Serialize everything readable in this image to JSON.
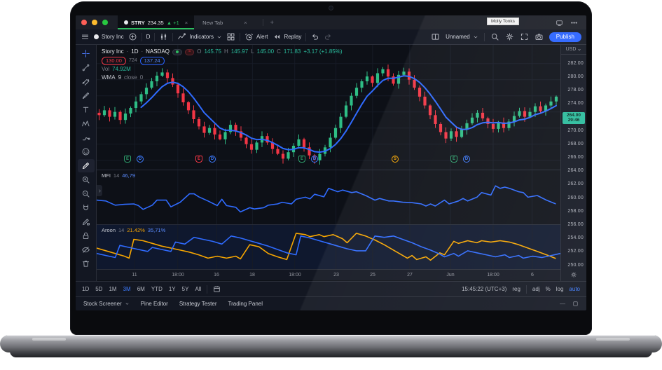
{
  "browser": {
    "tab_active": {
      "symbol": "STRY",
      "price": "234.35",
      "change": "▲ +1",
      "close": "×"
    },
    "tab_new": {
      "title": "New Tab",
      "close": "×"
    },
    "new_tab_button": "+",
    "user_tooltip": "Molly Tonks"
  },
  "toolbar": {
    "symbol_name": "Story Inc",
    "interval": "D",
    "indicators_label": "Indicators",
    "alert_label": "Alert",
    "replay_label": "Replay",
    "layout_name": "Unnamed",
    "publish_label": "Publish"
  },
  "side_toolbar": {
    "tools": [
      {
        "name": "crosshair",
        "blue": true
      },
      {
        "name": "trendline"
      },
      {
        "name": "channel"
      },
      {
        "name": "brush"
      },
      {
        "name": "text"
      },
      {
        "name": "xabcd-pattern"
      },
      {
        "name": "forecast"
      },
      {
        "name": "emoji"
      },
      {
        "name": "measure",
        "active": true
      },
      {
        "name": "zoom-in"
      },
      {
        "name": "zoom-out"
      },
      {
        "name": "magnet"
      },
      {
        "name": "drawing-mode"
      },
      {
        "name": "lock-drawings"
      },
      {
        "name": "hide-drawings"
      },
      {
        "name": "remove-drawings"
      }
    ]
  },
  "legend": {
    "name": "Story Inc",
    "sep1": "·",
    "interval": "1D",
    "sep2": "·",
    "exchange": "NASDAQ",
    "o_label": "O",
    "o": "145.75",
    "h_label": "H",
    "h": "145.97",
    "l_label": "L",
    "l": "145.00",
    "c_label": "C",
    "c": "171.83",
    "change": "+3.17 (+1.85%)",
    "alert_low": "130.00",
    "mid_value": "724",
    "alert_high": "137.24",
    "vol_label": "Vol",
    "vol": "74.92M",
    "wma_label": "WMA",
    "wma_period": "9",
    "wma_source": "close",
    "wma_offset": "0"
  },
  "mfi_legend": {
    "name": "MFI",
    "period": "14",
    "value": "46,79"
  },
  "aroon_legend": {
    "name": "Aroon",
    "period": "14",
    "up_value": "21.42%",
    "down_value": "35,71%"
  },
  "price_axis": {
    "currency": "USD",
    "ticks": [
      "282.00",
      "280.00",
      "278.00",
      "274.00",
      "270.00",
      "268.00",
      "266.00",
      "264.00",
      "262.00",
      "260.00",
      "258.00",
      "256.00",
      "254.00",
      "252.00",
      "250.00"
    ],
    "skip_after_index": 3,
    "current_price": "264.00",
    "countdown": "29:46"
  },
  "tf_bar": {
    "ranges": [
      "1D",
      "5D",
      "1M",
      "3M",
      "6M",
      "YTD",
      "1Y",
      "5Y",
      "All"
    ],
    "active_range": "3M",
    "clock": "15:45:22 (UTC+3)",
    "session": "reg",
    "adj": "adj",
    "percent": "%",
    "log": "log",
    "auto": "auto"
  },
  "status_bar": {
    "items": [
      "Stock Screener",
      "Pine Editor",
      "Strategy Tester",
      "Trading Panel"
    ]
  },
  "colors": {
    "up": "#2ebd85",
    "down": "#f23645",
    "wma": "#2f6bff",
    "mfi": "#2f6bff",
    "aroon_up": "#f7a600",
    "aroon_down": "#2f6bff",
    "accent": "#2962ff",
    "price_label_bg": "#2abb9c",
    "price_label_text": "#06261e",
    "grid": "#161b26",
    "tab_underline": "#2dbd5f",
    "earnings_badge": "#2e9e6b",
    "dividend_badge": "#3d7bff",
    "split_badge": "#f7a600",
    "earnings_miss_badge": "#f23645"
  },
  "chart_data": {
    "type": "candlestick+indicators",
    "title": "Story Inc · 1D · NASDAQ",
    "legend_position": "top-left",
    "grid": true,
    "main_panel": {
      "type": "candlestick",
      "price_range_visible": [
        266.5,
        281.8
      ],
      "first_open": 273.9,
      "closes": [
        273.6,
        274.2,
        273.4,
        274.0,
        273.0,
        273.8,
        274.5,
        275.3,
        276.2,
        277.0,
        277.8,
        278.5,
        278.9,
        278.2,
        277.4,
        276.3,
        275.2,
        274.2,
        273.1,
        272.2,
        271.4,
        272.0,
        271.2,
        270.6,
        271.5,
        272.4,
        271.6,
        270.8,
        270.0,
        269.3,
        270.2,
        271.0,
        270.2,
        269.4,
        268.8,
        268.2,
        269.0,
        269.8,
        270.6,
        269.6,
        268.6,
        268.0,
        268.8,
        269.6,
        270.8,
        272.0,
        273.4,
        274.8,
        276.0,
        277.0,
        277.8,
        278.4,
        277.6,
        278.8,
        279.3,
        278.4,
        277.5,
        278.6,
        279.0,
        278.0,
        277.0,
        275.9,
        274.8,
        273.6,
        272.5,
        271.5,
        270.7,
        271.6,
        270.9,
        271.8,
        272.6,
        273.3,
        273.9,
        273.2,
        272.5,
        271.9,
        272.7,
        272.0,
        272.8,
        273.5,
        274.1,
        273.4,
        274.0,
        274.7,
        274.1,
        274.8,
        275.3,
        275.9
      ],
      "overlay": {
        "name": "WMA",
        "period": 9,
        "source": "close"
      }
    },
    "mfi_panel": {
      "type": "line",
      "name": "MFI",
      "period": 14,
      "last_value": 46.79,
      "range": [
        0,
        100
      ],
      "points": [
        [
          0.0,
          49
        ],
        [
          0.02,
          47
        ],
        [
          0.04,
          37
        ],
        [
          0.06,
          39
        ],
        [
          0.08,
          40
        ],
        [
          0.09,
          36
        ],
        [
          0.1,
          27
        ],
        [
          0.12,
          37
        ],
        [
          0.13,
          49
        ],
        [
          0.15,
          49
        ],
        [
          0.16,
          33
        ],
        [
          0.18,
          44
        ],
        [
          0.2,
          64
        ],
        [
          0.21,
          64
        ],
        [
          0.22,
          57
        ],
        [
          0.24,
          47
        ],
        [
          0.26,
          36
        ],
        [
          0.27,
          51
        ],
        [
          0.28,
          36
        ],
        [
          0.3,
          32
        ],
        [
          0.31,
          21
        ],
        [
          0.33,
          31
        ],
        [
          0.34,
          28
        ],
        [
          0.36,
          31
        ],
        [
          0.37,
          37
        ],
        [
          0.39,
          40
        ],
        [
          0.4,
          44
        ],
        [
          0.42,
          40
        ],
        [
          0.43,
          51
        ],
        [
          0.45,
          56
        ],
        [
          0.46,
          52
        ],
        [
          0.47,
          63
        ],
        [
          0.49,
          57
        ],
        [
          0.5,
          77
        ],
        [
          0.52,
          69
        ],
        [
          0.53,
          73
        ],
        [
          0.55,
          67
        ],
        [
          0.56,
          69
        ],
        [
          0.58,
          60
        ],
        [
          0.6,
          49
        ],
        [
          0.61,
          53
        ],
        [
          0.63,
          47
        ],
        [
          0.64,
          47
        ],
        [
          0.66,
          44
        ],
        [
          0.68,
          43
        ],
        [
          0.7,
          40
        ],
        [
          0.71,
          35
        ],
        [
          0.72,
          40
        ],
        [
          0.73,
          35
        ],
        [
          0.75,
          49
        ],
        [
          0.76,
          40
        ],
        [
          0.78,
          47
        ],
        [
          0.79,
          53
        ],
        [
          0.8,
          47
        ],
        [
          0.82,
          56
        ],
        [
          0.83,
          67
        ],
        [
          0.85,
          61
        ],
        [
          0.86,
          83
        ],
        [
          0.87,
          77
        ],
        [
          0.88,
          80
        ],
        [
          0.89,
          77
        ],
        [
          0.91,
          69
        ],
        [
          0.92,
          67
        ],
        [
          0.93,
          56
        ],
        [
          0.95,
          60
        ],
        [
          0.97,
          49
        ],
        [
          0.99,
          40
        ]
      ]
    },
    "aroon_panel": {
      "type": "line",
      "name": "Aroon",
      "period": 14,
      "range": [
        0,
        100
      ],
      "up_last": 21.42,
      "down_last": 35.71,
      "up": [
        [
          0,
          52
        ],
        [
          0.03,
          40
        ],
        [
          0.06,
          28
        ],
        [
          0.07,
          22
        ],
        [
          0.08,
          78
        ],
        [
          0.1,
          74
        ],
        [
          0.12,
          66
        ],
        [
          0.14,
          58
        ],
        [
          0.16,
          52
        ],
        [
          0.18,
          46
        ],
        [
          0.2,
          40
        ],
        [
          0.22,
          32
        ],
        [
          0.24,
          22
        ],
        [
          0.26,
          28
        ],
        [
          0.28,
          22
        ],
        [
          0.3,
          28
        ],
        [
          0.31,
          20
        ],
        [
          0.33,
          62
        ],
        [
          0.35,
          56
        ],
        [
          0.37,
          36
        ],
        [
          0.39,
          26
        ],
        [
          0.41,
          18
        ],
        [
          0.43,
          96
        ],
        [
          0.45,
          92
        ],
        [
          0.46,
          86
        ],
        [
          0.48,
          92
        ],
        [
          0.49,
          86
        ],
        [
          0.51,
          92
        ],
        [
          0.53,
          80
        ],
        [
          0.54,
          68
        ],
        [
          0.56,
          96
        ],
        [
          0.58,
          88
        ],
        [
          0.6,
          76
        ],
        [
          0.62,
          62
        ],
        [
          0.64,
          46
        ],
        [
          0.66,
          30
        ],
        [
          0.67,
          22
        ],
        [
          0.68,
          30
        ],
        [
          0.69,
          18
        ],
        [
          0.71,
          26
        ],
        [
          0.72,
          16
        ],
        [
          0.74,
          38
        ],
        [
          0.75,
          32
        ],
        [
          0.77,
          72
        ],
        [
          0.78,
          66
        ],
        [
          0.8,
          74
        ],
        [
          0.82,
          68
        ],
        [
          0.83,
          74
        ],
        [
          0.85,
          70
        ],
        [
          0.87,
          74
        ],
        [
          0.89,
          70
        ],
        [
          0.91,
          62
        ],
        [
          0.93,
          52
        ],
        [
          0.95,
          42
        ],
        [
          0.97,
          32
        ],
        [
          0.99,
          21
        ]
      ],
      "down": [
        [
          0,
          36
        ],
        [
          0.02,
          30
        ],
        [
          0.04,
          24
        ],
        [
          0.05,
          60
        ],
        [
          0.07,
          54
        ],
        [
          0.09,
          48
        ],
        [
          0.11,
          42
        ],
        [
          0.12,
          54
        ],
        [
          0.14,
          48
        ],
        [
          0.16,
          42
        ],
        [
          0.17,
          70
        ],
        [
          0.19,
          64
        ],
        [
          0.21,
          84
        ],
        [
          0.23,
          78
        ],
        [
          0.25,
          72
        ],
        [
          0.27,
          64
        ],
        [
          0.29,
          88
        ],
        [
          0.31,
          82
        ],
        [
          0.33,
          74
        ],
        [
          0.35,
          66
        ],
        [
          0.37,
          58
        ],
        [
          0.39,
          48
        ],
        [
          0.41,
          38
        ],
        [
          0.43,
          32
        ],
        [
          0.44,
          88
        ],
        [
          0.46,
          82
        ],
        [
          0.48,
          74
        ],
        [
          0.5,
          66
        ],
        [
          0.52,
          58
        ],
        [
          0.54,
          50
        ],
        [
          0.56,
          44
        ],
        [
          0.58,
          44
        ],
        [
          0.6,
          88
        ],
        [
          0.62,
          84
        ],
        [
          0.64,
          88
        ],
        [
          0.66,
          78
        ],
        [
          0.68,
          68
        ],
        [
          0.7,
          56
        ],
        [
          0.72,
          46
        ],
        [
          0.74,
          34
        ],
        [
          0.75,
          26
        ],
        [
          0.77,
          36
        ],
        [
          0.78,
          28
        ],
        [
          0.8,
          44
        ],
        [
          0.82,
          38
        ],
        [
          0.84,
          32
        ],
        [
          0.86,
          26
        ],
        [
          0.88,
          32
        ],
        [
          0.89,
          24
        ],
        [
          0.91,
          30
        ],
        [
          0.92,
          22
        ],
        [
          0.94,
          28
        ],
        [
          0.96,
          24
        ],
        [
          0.98,
          30
        ],
        [
          1.0,
          36
        ]
      ]
    },
    "time_ticks": [
      [
        "11",
        0.082
      ],
      [
        "18:00",
        0.175
      ],
      [
        "16",
        0.259
      ],
      [
        "18",
        0.336
      ],
      [
        "18:00",
        0.427
      ],
      [
        "23",
        0.516
      ],
      [
        "25",
        0.595
      ],
      [
        "27",
        0.675
      ],
      [
        "Jun",
        0.763
      ],
      [
        "18:00",
        0.855
      ],
      [
        "6",
        0.939
      ]
    ],
    "events": [
      {
        "f": 0.066,
        "letter": "E",
        "kind": "earnings"
      },
      {
        "f": 0.093,
        "letter": "D",
        "kind": "dividend"
      },
      {
        "f": 0.221,
        "letter": "E",
        "kind": "earnings-miss"
      },
      {
        "f": 0.249,
        "letter": "D",
        "kind": "dividend"
      },
      {
        "f": 0.443,
        "letter": "E",
        "kind": "earnings"
      },
      {
        "f": 0.47,
        "letter": "D",
        "kind": "dividend"
      },
      {
        "f": 0.644,
        "letter": "S",
        "kind": "split"
      },
      {
        "f": 0.771,
        "letter": "E",
        "kind": "earnings"
      },
      {
        "f": 0.798,
        "letter": "D",
        "kind": "dividend"
      }
    ]
  }
}
